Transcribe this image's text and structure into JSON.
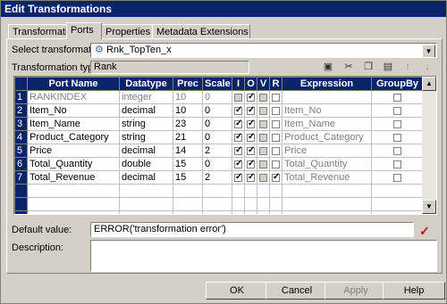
{
  "title": "Edit Transformations",
  "tabs": [
    "Transformation",
    "Ports",
    "Properties",
    "Metadata Extensions"
  ],
  "select_label": "Select transformation:",
  "select_value": "Rnk_TopTen_x",
  "type_label": "Transformation type:",
  "type_value": "Rank",
  "toolbar_icons": [
    "new-port-icon",
    "cut-icon",
    "copy-icon",
    "paste-icon",
    "move-up-icon",
    "move-down-icon"
  ],
  "columns": [
    "Port Name",
    "Datatype",
    "Prec",
    "Scale",
    "I",
    "O",
    "V",
    "R",
    "Expression",
    "GroupBy"
  ],
  "rows": [
    {
      "n": "1",
      "name": "RANKINDEX",
      "type": "integer",
      "prec": "10",
      "scale": "0",
      "i": false,
      "o": true,
      "v": false,
      "r": false,
      "expr": "",
      "gb": false,
      "grey": true
    },
    {
      "n": "2",
      "name": "Item_No",
      "type": "decimal",
      "prec": "10",
      "scale": "0",
      "i": true,
      "o": true,
      "v": false,
      "r": false,
      "expr": "Item_No",
      "gb": false,
      "grey": false
    },
    {
      "n": "3",
      "name": "Item_Name",
      "type": "string",
      "prec": "23",
      "scale": "0",
      "i": true,
      "o": true,
      "v": false,
      "r": false,
      "expr": "Item_Name",
      "gb": false,
      "grey": false
    },
    {
      "n": "4",
      "name": "Product_Category",
      "type": "string",
      "prec": "21",
      "scale": "0",
      "i": true,
      "o": true,
      "v": false,
      "r": false,
      "expr": "Product_Category",
      "gb": false,
      "grey": false
    },
    {
      "n": "5",
      "name": "Price",
      "type": "decimal",
      "prec": "14",
      "scale": "2",
      "i": true,
      "o": true,
      "v": false,
      "r": false,
      "expr": "Price",
      "gb": false,
      "grey": false
    },
    {
      "n": "6",
      "name": "Total_Quantity",
      "type": "double",
      "prec": "15",
      "scale": "0",
      "i": true,
      "o": true,
      "v": false,
      "r": false,
      "expr": "Total_Quantity",
      "gb": false,
      "grey": false
    },
    {
      "n": "7",
      "name": "Total_Revenue",
      "type": "decimal",
      "prec": "15",
      "scale": "2",
      "i": true,
      "o": true,
      "v": false,
      "r": true,
      "expr": "Total_Revenue",
      "gb": false,
      "grey": false
    }
  ],
  "default_label": "Default value:",
  "default_value": "ERROR('transformation error')",
  "description_label": "Description:",
  "description_value": "",
  "buttons": {
    "ok": "OK",
    "cancel": "Cancel",
    "apply": "Apply",
    "help": "Help"
  }
}
